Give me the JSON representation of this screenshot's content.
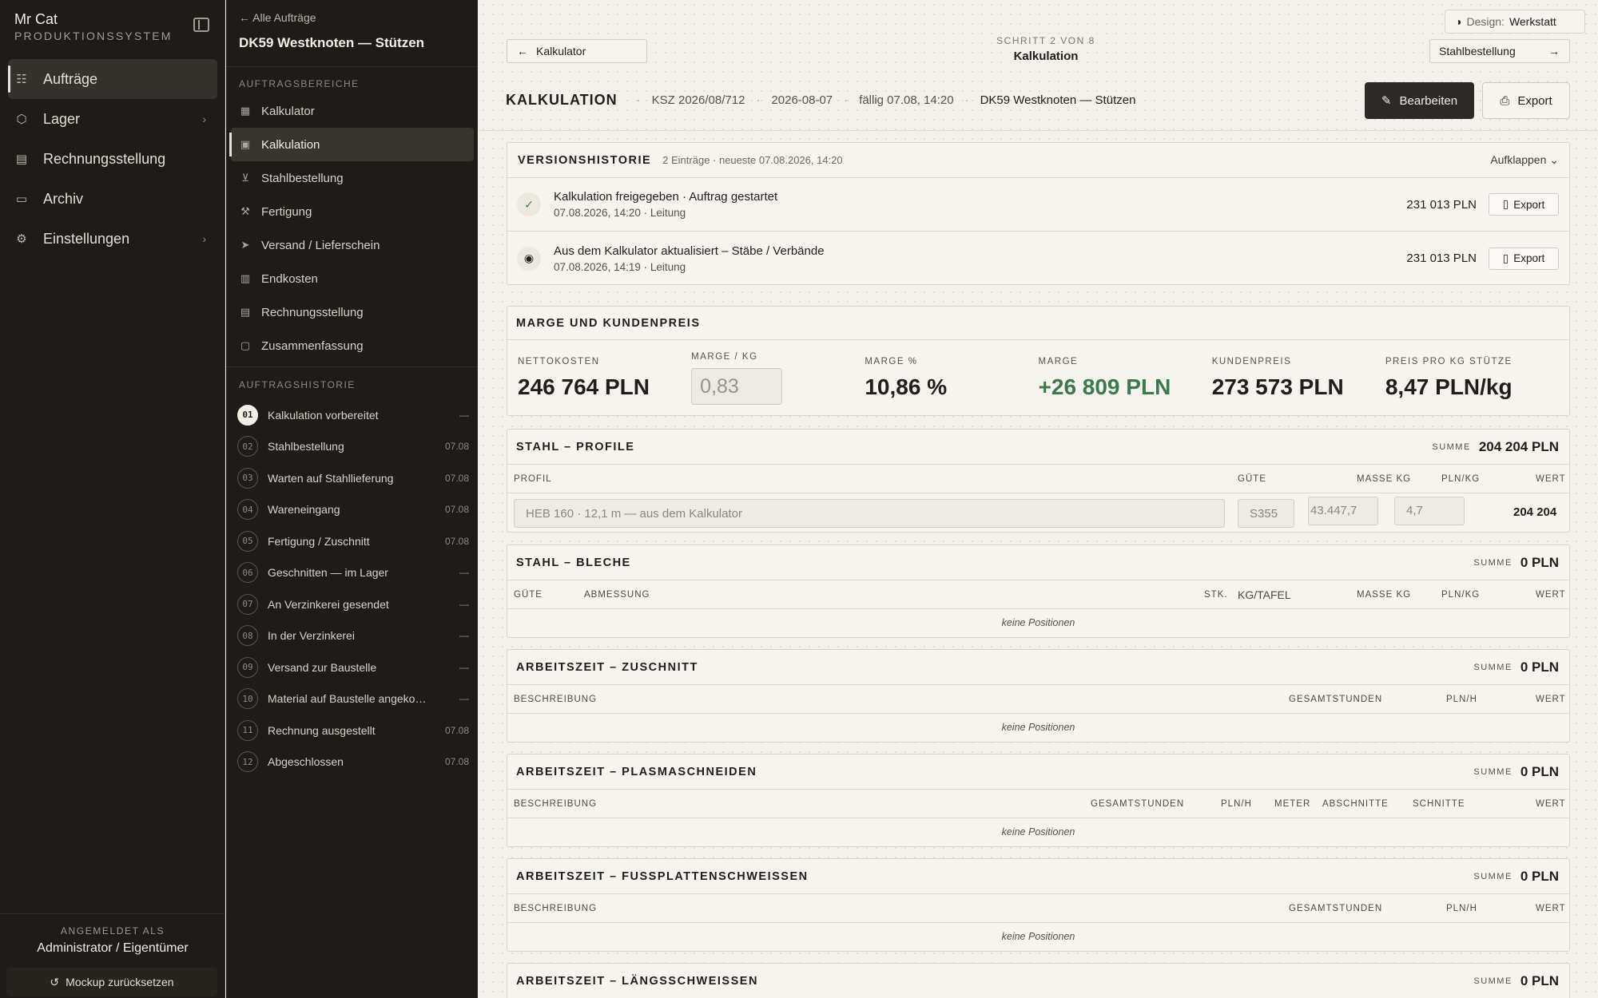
{
  "app": {
    "name": "Mr Cat",
    "subtitle": "PRODUKTIONSSYSTEM"
  },
  "sidebar": {
    "items": [
      {
        "label": "Aufträge",
        "icon": "list-check-icon",
        "active": true
      },
      {
        "label": "Lager",
        "icon": "box-icon",
        "chevron": true
      },
      {
        "label": "Rechnungsstellung",
        "icon": "document-icon"
      },
      {
        "label": "Archiv",
        "icon": "archive-icon"
      },
      {
        "label": "Einstellungen",
        "icon": "gear-icon",
        "chevron": true
      }
    ],
    "logged_in_label": "ANGEMELDET ALS",
    "user": "Administrator / Eigentümer",
    "reset_label": "Mockup zurücksetzen"
  },
  "order": {
    "back_label": "Alle Aufträge",
    "title": "DK59 Westknoten — Stützen",
    "areas_label": "AUFTRAGSBEREICHE",
    "areas": [
      {
        "label": "Kalkulator",
        "icon": "calculator-icon"
      },
      {
        "label": "Kalkulation",
        "icon": "wallet-icon",
        "active": true
      },
      {
        "label": "Stahlbestellung",
        "icon": "cart-icon"
      },
      {
        "label": "Fertigung",
        "icon": "hammer-icon"
      },
      {
        "label": "Versand / Lieferschein",
        "icon": "send-icon"
      },
      {
        "label": "Endkosten",
        "icon": "receipt-icon"
      },
      {
        "label": "Rechnungsstellung",
        "icon": "document-icon"
      },
      {
        "label": "Zusammenfassung",
        "icon": "clipboard-icon"
      }
    ],
    "history_label": "AUFTRAGSHISTORIE",
    "history": [
      {
        "num": "01",
        "label": "Kalkulation vorbereitet",
        "date": "—"
      },
      {
        "num": "02",
        "label": "Stahlbestellung",
        "date": "07.08"
      },
      {
        "num": "03",
        "label": "Warten auf Stahllieferung",
        "date": "07.08"
      },
      {
        "num": "04",
        "label": "Wareneingang",
        "date": "07.08"
      },
      {
        "num": "05",
        "label": "Fertigung / Zuschnitt",
        "date": "07.08"
      },
      {
        "num": "06",
        "label": "Geschnitten — im Lager",
        "date": "—"
      },
      {
        "num": "07",
        "label": "An Verzinkerei gesendet",
        "date": "—"
      },
      {
        "num": "08",
        "label": "In der Verzinkerei",
        "date": "—"
      },
      {
        "num": "09",
        "label": "Versand zur Baustelle",
        "date": "—"
      },
      {
        "num": "10",
        "label": "Material auf Baustelle angekommen",
        "date": "—"
      },
      {
        "num": "11",
        "label": "Rechnung ausgestellt",
        "date": "07.08"
      },
      {
        "num": "12",
        "label": "Abgeschlossen",
        "date": "07.08"
      }
    ]
  },
  "topbar": {
    "design_label": "Design:",
    "design_value": "Werkstatt",
    "prev_step": "Kalkulator",
    "next_step": "Stahlbestellung",
    "step_count": "SCHRITT 2 VON 8",
    "step_name": "Kalkulation"
  },
  "header": {
    "title": "KALKULATION",
    "number": "KSZ 2026/08/712",
    "date": "2026-08-07",
    "due": "fällig 07.08, 14:20",
    "project": "DK59 Westknoten — Stützen",
    "edit_label": "Bearbeiten",
    "export_label": "Export"
  },
  "version_history": {
    "title": "VERSIONSHISTORIE",
    "summary": "2 Einträge · neueste 07.08.2026, 14:20",
    "collapse_label": "Aufklappen",
    "entries": [
      {
        "title": "Kalkulation freigegeben · Auftrag gestartet",
        "meta": "07.08.2026, 14:20 · Leitung",
        "amount": "231 013 PLN",
        "export": "Export",
        "icon": "check-icon"
      },
      {
        "title": "Aus dem Kalkulator aktualisiert – Stäbe / Verbände",
        "meta": "07.08.2026, 14:19 · Leitung",
        "amount": "231 013 PLN",
        "export": "Export",
        "icon": "refresh-icon"
      }
    ]
  },
  "margin": {
    "title": "MARGE UND KUNDENPREIS",
    "net_label": "NETTOKOSTEN",
    "net_value": "246 764 PLN",
    "per_kg_label": "MARGE / KG",
    "per_kg_placeholder": "0,83",
    "pct_label": "MARGE %",
    "pct_value": "10,86 %",
    "margin_label": "MARGE",
    "margin_value": "+26 809 PLN",
    "customer_label": "KUNDENPREIS",
    "customer_value": "273 573 PLN",
    "kg_price_label": "PREIS PRO KG STÜTZE",
    "kg_price_value": "8,47 PLN/kg"
  },
  "sections": {
    "sum_label": "SUMME",
    "empty_label": "keine Positionen",
    "profiles": {
      "title": "STAHL – PROFILE",
      "sum": "204 204 PLN",
      "cols": [
        "PROFIL",
        "GÜTE",
        "MASSE KG",
        "PLN/KG",
        "WERT"
      ],
      "row": {
        "profile": "HEB 160 · 12,1 m — aus dem Kalkulator",
        "grade": "S355",
        "mass": "43.447,7",
        "price": "4,7",
        "value": "204 204"
      }
    },
    "sheets": {
      "title": "STAHL – BLECHE",
      "sum": "0 PLN",
      "cols": [
        "GÜTE",
        "ABMESSUNG",
        "STK.",
        "KG/TAFEL",
        "MASSE KG",
        "PLN/KG",
        "WERT"
      ]
    },
    "cutting": {
      "title": "ARBEITSZEIT – ZUSCHNITT",
      "sum": "0 PLN",
      "cols": [
        "BESCHREIBUNG",
        "GESAMTSTUNDEN",
        "PLN/H",
        "WERT"
      ]
    },
    "plasma": {
      "title": "ARBEITSZEIT – PLASMASCHNEIDEN",
      "sum": "0 PLN",
      "cols": [
        "BESCHREIBUNG",
        "GESAMTSTUNDEN",
        "PLN/H",
        "METER",
        "ABSCHNITTE",
        "SCHNITTE",
        "WERT"
      ]
    },
    "baseplate": {
      "title": "ARBEITSZEIT – FUSSPLATTENSCHWEISSEN",
      "sum": "0 PLN",
      "cols": [
        "BESCHREIBUNG",
        "GESAMTSTUNDEN",
        "PLN/H",
        "WERT"
      ]
    },
    "longweld": {
      "title": "ARBEITSZEIT – LÄNGSSCHWEISSEN",
      "sum": "0 PLN"
    }
  }
}
